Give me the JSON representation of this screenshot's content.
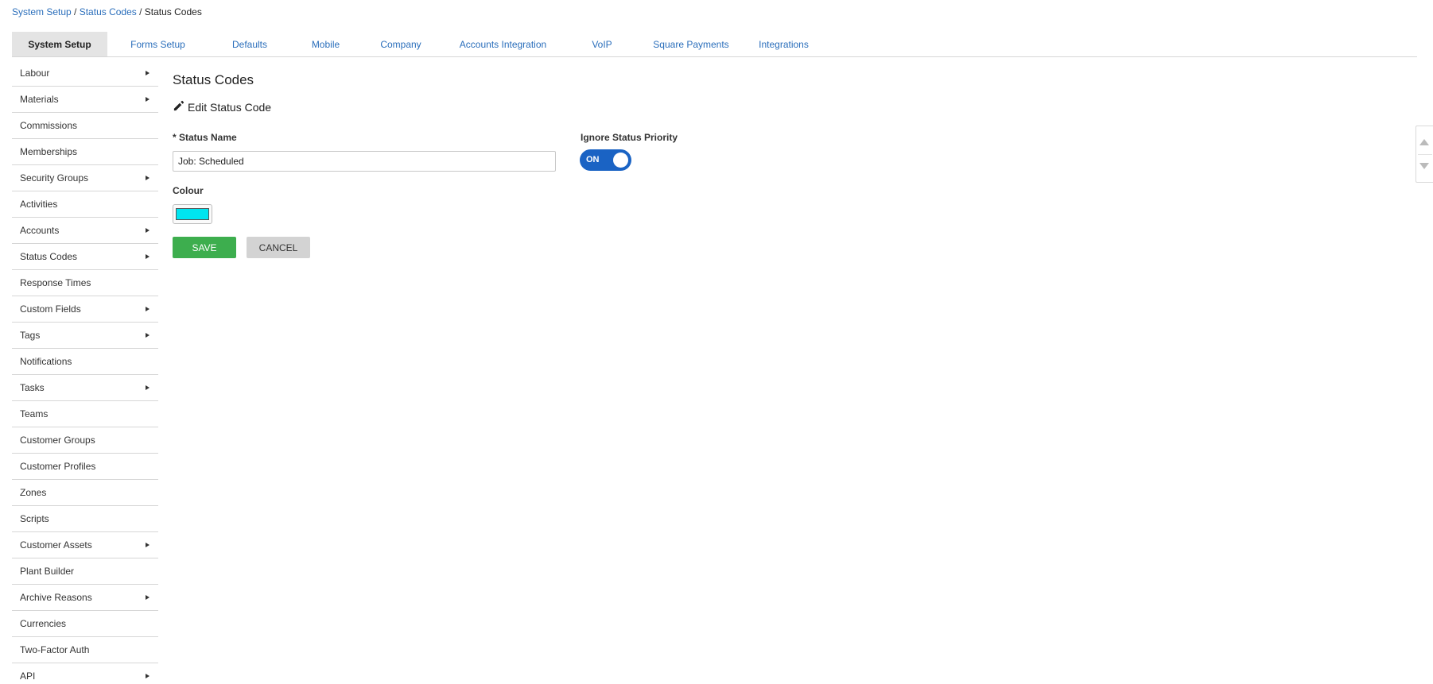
{
  "breadcrumb": {
    "items": [
      "System Setup",
      "Status Codes"
    ],
    "separator": " / ",
    "current": "Status Codes"
  },
  "tabs": [
    {
      "label": "System Setup",
      "active": true
    },
    {
      "label": "Forms Setup"
    },
    {
      "label": "Defaults"
    },
    {
      "label": "Mobile"
    },
    {
      "label": "Company"
    },
    {
      "label": "Accounts Integration"
    },
    {
      "label": "VoIP"
    },
    {
      "label": "Square Payments"
    },
    {
      "label": "Integrations"
    }
  ],
  "sidebar": {
    "items": [
      {
        "label": "Labour",
        "has_submenu": true
      },
      {
        "label": "Materials",
        "has_submenu": true
      },
      {
        "label": "Commissions",
        "has_submenu": false
      },
      {
        "label": "Memberships",
        "has_submenu": false
      },
      {
        "label": "Security Groups",
        "has_submenu": true
      },
      {
        "label": "Activities",
        "has_submenu": false
      },
      {
        "label": "Accounts",
        "has_submenu": true
      },
      {
        "label": "Status Codes",
        "has_submenu": true
      },
      {
        "label": "Response Times",
        "has_submenu": false
      },
      {
        "label": "Custom Fields",
        "has_submenu": true
      },
      {
        "label": "Tags",
        "has_submenu": true
      },
      {
        "label": "Notifications",
        "has_submenu": false
      },
      {
        "label": "Tasks",
        "has_submenu": true
      },
      {
        "label": "Teams",
        "has_submenu": false
      },
      {
        "label": "Customer Groups",
        "has_submenu": false
      },
      {
        "label": "Customer Profiles",
        "has_submenu": false
      },
      {
        "label": "Zones",
        "has_submenu": false
      },
      {
        "label": "Scripts",
        "has_submenu": false
      },
      {
        "label": "Customer Assets",
        "has_submenu": true
      },
      {
        "label": "Plant Builder",
        "has_submenu": false
      },
      {
        "label": "Archive Reasons",
        "has_submenu": true
      },
      {
        "label": "Currencies",
        "has_submenu": false
      },
      {
        "label": "Two-Factor Auth",
        "has_submenu": false
      },
      {
        "label": "API",
        "has_submenu": true
      }
    ]
  },
  "main": {
    "title": "Status Codes",
    "subtitle": "Edit Status Code",
    "subtitle_icon": "pencil-icon",
    "status_name_label": "* Status Name",
    "status_name_value": "Job: Scheduled",
    "ignore_priority_label": "Ignore Status Priority",
    "ignore_priority_state": "ON",
    "colour_label": "Colour",
    "colour_value": "#00e5f0",
    "save_label": "SAVE",
    "cancel_label": "CANCEL"
  },
  "colors": {
    "link": "#2a6ebb",
    "save": "#3dae4e",
    "toggle_on": "#1a63c4"
  }
}
